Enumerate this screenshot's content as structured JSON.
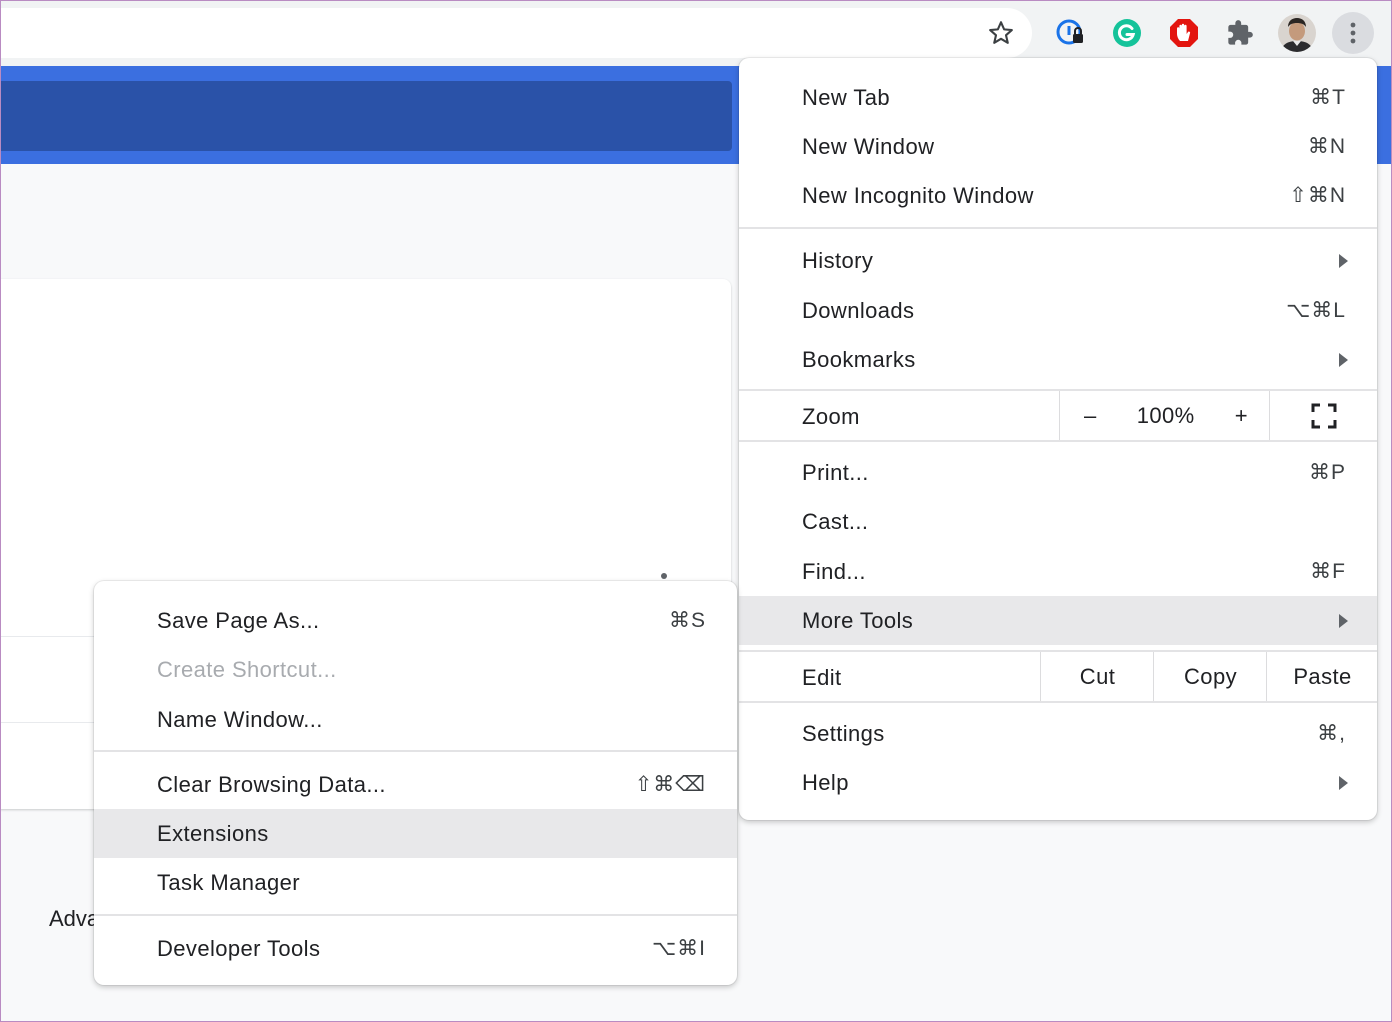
{
  "page": {
    "partial_text": "Adva"
  },
  "toolbar": {
    "icons": [
      "bookmark-star-icon",
      "password-manager-icon",
      "grammarly-icon",
      "adblock-icon",
      "extensions-puzzle-icon",
      "profile-avatar",
      "more-menu-icon"
    ]
  },
  "main_menu": {
    "new_tab": {
      "label": "New Tab",
      "shortcut": "⌘T"
    },
    "new_window": {
      "label": "New Window",
      "shortcut": "⌘N"
    },
    "new_incognito": {
      "label": "New Incognito Window",
      "shortcut": "⇧⌘N"
    },
    "history": {
      "label": "History"
    },
    "downloads": {
      "label": "Downloads",
      "shortcut": "⌥⌘L"
    },
    "bookmarks": {
      "label": "Bookmarks"
    },
    "zoom": {
      "label": "Zoom",
      "minus": "–",
      "value": "100%",
      "plus": "+"
    },
    "print": {
      "label": "Print...",
      "shortcut": "⌘P"
    },
    "cast": {
      "label": "Cast..."
    },
    "find": {
      "label": "Find...",
      "shortcut": "⌘F"
    },
    "more_tools": {
      "label": "More Tools"
    },
    "edit": {
      "label": "Edit",
      "cut": "Cut",
      "copy": "Copy",
      "paste": "Paste"
    },
    "settings": {
      "label": "Settings",
      "shortcut": "⌘,"
    },
    "help": {
      "label": "Help"
    }
  },
  "sub_menu": {
    "save_page": {
      "label": "Save Page As...",
      "shortcut": "⌘S"
    },
    "create_shortcut": {
      "label": "Create Shortcut..."
    },
    "name_window": {
      "label": "Name Window..."
    },
    "clear_data": {
      "label": "Clear Browsing Data...",
      "shortcut": "⇧⌘⌫"
    },
    "extensions": {
      "label": "Extensions"
    },
    "task_manager": {
      "label": "Task Manager"
    },
    "dev_tools": {
      "label": "Developer Tools",
      "shortcut": "⌥⌘I"
    }
  },
  "colors": {
    "accent_blue": "#3b6fe0",
    "dark_blue": "#2a52a8",
    "highlight": "#e8e8ea"
  }
}
